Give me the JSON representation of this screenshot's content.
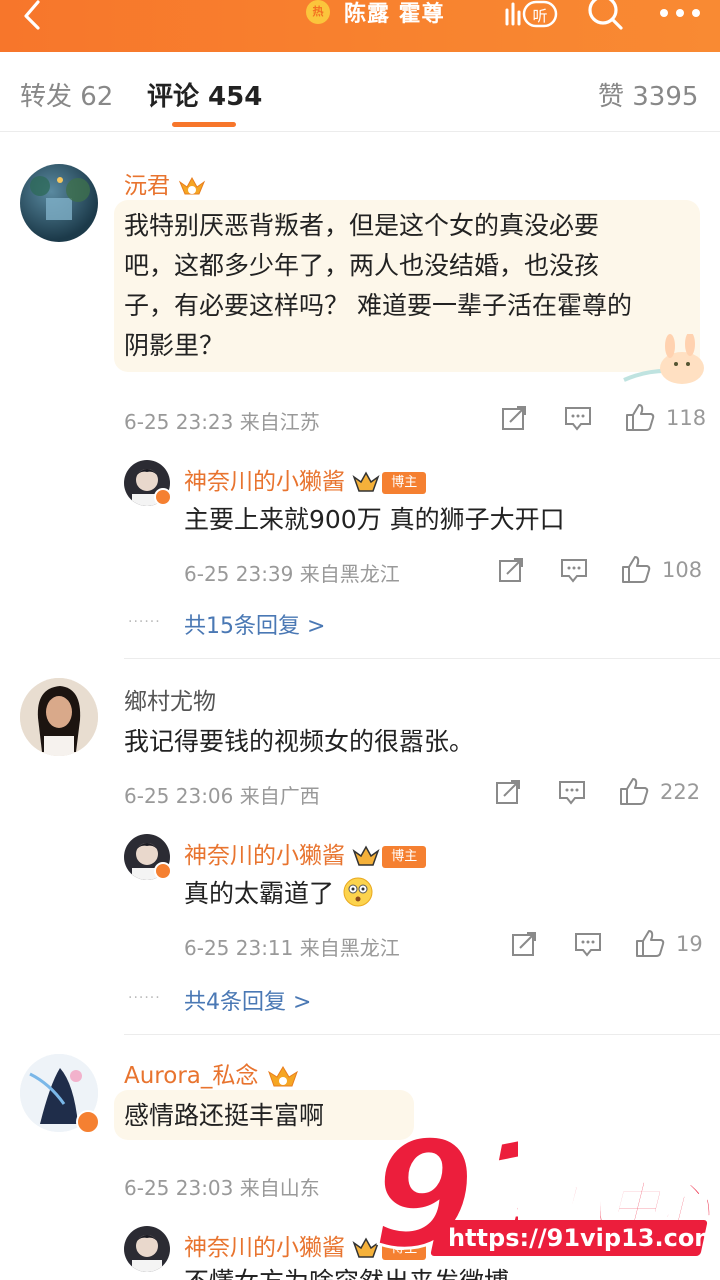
{
  "header": {
    "hot_label": "热",
    "title": "陈露 霍尊",
    "accent": "#f7762b"
  },
  "tabs": [
    {
      "label": "转发 62"
    },
    {
      "label": "评论 454"
    },
    {
      "label": "赞 3395"
    }
  ],
  "comments": [
    {
      "user": "沅君",
      "text": [
        "我特别厌恶背叛者，但是这个女的真没必要",
        "吧，这都多少年了，两人也没结婚，也没孩",
        "子，有必要这样吗？ 难道要一辈子活在霍尊的",
        "阴影里？"
      ],
      "meta": "6-25 23:23 来自江苏",
      "likes": "118",
      "reply": {
        "user": "神奈川的小獭酱",
        "badge": "博主",
        "text": "主要上来就900万 真的狮子大开口",
        "meta": "6-25 23:39 来自黑龙江",
        "likes": "108"
      },
      "more": "共15条回复 >"
    },
    {
      "user": "鄉村尤物",
      "text": [
        "我记得要钱的视频女的很嚣张。"
      ],
      "meta": "6-25 23:06 来自广西",
      "likes": "222",
      "reply": {
        "user": "神奈川的小獭酱",
        "badge": "博主",
        "text": "真的太霸道了",
        "meta": "6-25 23:11 来自黑龙江",
        "likes": "19"
      },
      "more": "共4条回复 >"
    },
    {
      "user": "Aurora_私念",
      "text": [
        "感情路还挺丰富啊"
      ],
      "meta": "6-25 23:03 来自山东",
      "reply": {
        "user": "神奈川的小獭酱",
        "badge": "博主",
        "text": "不懂女方为啥突然出来发微博"
      }
    }
  ],
  "watermark": {
    "number": "91",
    "title": "吃瓜中心",
    "url": "https://91vip13.com"
  }
}
